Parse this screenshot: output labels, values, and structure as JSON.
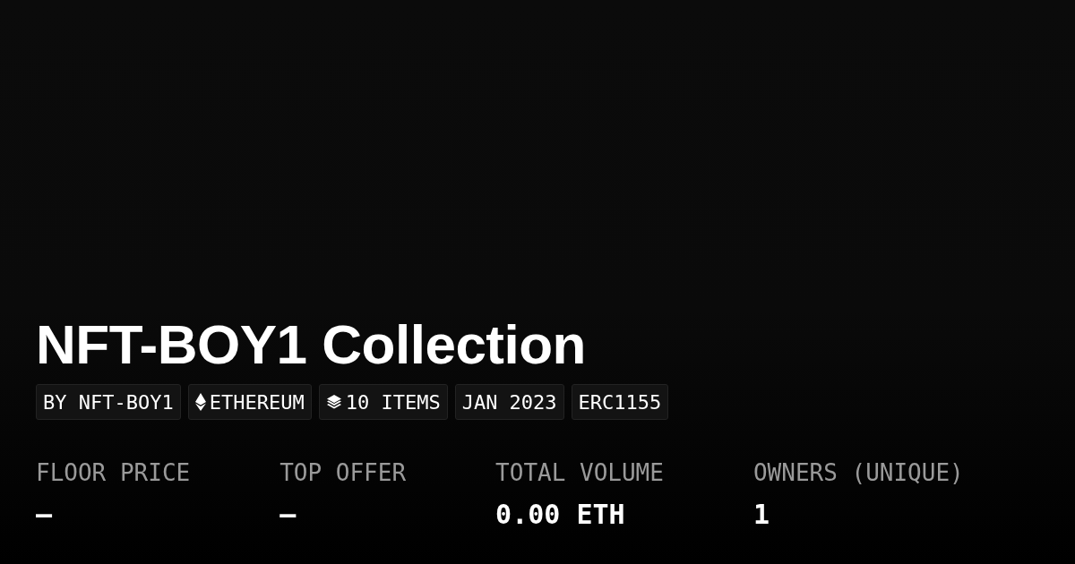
{
  "title": "NFT-BOY1 Collection",
  "tags": [
    {
      "kind": "creator",
      "label": "BY NFT-BOY1"
    },
    {
      "kind": "chain",
      "label": "ETHEREUM"
    },
    {
      "kind": "items",
      "label": "10 ITEMS"
    },
    {
      "kind": "date",
      "label": "JAN 2023"
    },
    {
      "kind": "standard",
      "label": "ERC1155"
    }
  ],
  "stats": [
    {
      "label": "FLOOR PRICE",
      "value": "–"
    },
    {
      "label": "TOP OFFER",
      "value": "–"
    },
    {
      "label": "TOTAL VOLUME",
      "value": "0.00 ETH"
    },
    {
      "label": "OWNERS (UNIQUE)",
      "value": "1"
    }
  ]
}
